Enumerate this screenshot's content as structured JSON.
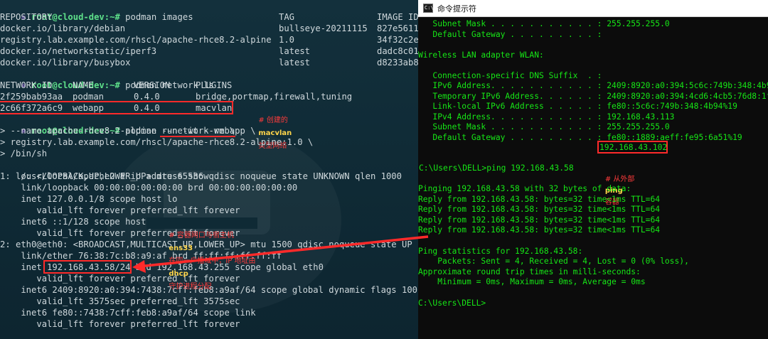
{
  "terminal": {
    "prompt_user": "root@cloud-dev:~#",
    "cmd_images": "podman images",
    "images_header": {
      "repository": "REPOSITORY",
      "tag": "TAG",
      "image_id": "IMAGE ID"
    },
    "images": [
      {
        "repository": "docker.io/library/debian",
        "tag": "bullseye-20211115",
        "image_id": "827e5611"
      },
      {
        "repository": "registry.lab.example.com/rhscl/apache-rhce8.2-alpine",
        "tag": "1.0",
        "image_id": "34f32c2e"
      },
      {
        "repository": "docker.io/networkstatic/iperf3",
        "tag": "latest",
        "image_id": "dadc8c01"
      },
      {
        "repository": "docker.io/library/busybox",
        "tag": "latest",
        "image_id": "d8233ab8"
      }
    ],
    "cmd_network": "podman network ls",
    "network_header": {
      "id": "NETWORK ID",
      "name": "NAME",
      "version": "VERSION",
      "plugins": "PLUGINS"
    },
    "networks": [
      {
        "id": "2f259bab93aa",
        "name": "podman",
        "version": "0.4.0",
        "plugins": "bridge,portmap,firewall,tuning"
      },
      {
        "id": "2c66f372a6c9",
        "name": "webapp",
        "version": "0.4.0",
        "plugins": "macvlan"
      }
    ],
    "annotation_network": {
      "prefix": "# 创建的",
      "keyword": "macvlan",
      "suffix": "类型网络"
    },
    "cmd_run": "podman run -it --rm \\",
    "run_lines": [
      "> --name apache-rhce8.2-alpine --network webapp \\",
      "> registry.lab.example.com/rhscl/apache-rhce8.2-alpine:1.0 \\",
      "> /bin/sh"
    ],
    "shell_prompt": "/usr/local/apache2 #",
    "cmd_ip": "ip address show",
    "ip_output": [
      "1: lo: <LOOPBACK,UP,LOWER_UP> mtu 65536 qdisc noqueue state UNKNOWN qlen 1000",
      "    link/loopback 00:00:00:00:00:00 brd 00:00:00:00:00:00",
      "    inet 127.0.0.1/8 scope host lo",
      "       valid_lft forever preferred_lft forever",
      "    inet6 ::1/128 scope host",
      "       valid_lft forever preferred_lft forever",
      "2: eth0@eth0: <BROADCAST,MULTICAST,UP,LOWER_UP> mtu 1500 qdisc noqueue state UP",
      "    link/ether 76:38:7c:b8:a9:af brd ff:ff:ff:ff:ff:ff",
      "    inet 192.168.43.58/24 brd 192.168.43.255 scope global eth0",
      "       valid_lft forever preferred_lft forever",
      "    inet6 2409:8920:a0:394:7438:7cff:feb8:a9af/64 scope global dynamic flags 100",
      "       valid_lft 3575sec preferred_lft 3575sec",
      "    inet6 fe80::7438:7cff:feb8:a9af/64 scope link",
      "       valid_lft forever preferred_lft forever"
    ],
    "container_ip": "192.168.43.58/24",
    "annotation_ip": {
      "p1": "# 容器网口与宿主机",
      "k1": "ens33",
      "p2": "在同一广播域中，IP 地址由",
      "k2": "dhcp",
      "p3": "守护进程分配"
    }
  },
  "cmd": {
    "title": "命令提示符",
    "icon_text": "C:\\",
    "top_lines": [
      "   Subnet Mask . . . . . . . . . . . : 255.255.255.0",
      "   Default Gateway . . . . . . . . . :",
      "",
      "Wireless LAN adapter WLAN:",
      "",
      "   Connection-specific DNS Suffix  . :",
      "   IPv6 Address. . . . . . . . . . . : 2409:8920:a0:394:5c6c:749b:348:4b94",
      "   Temporary IPv6 Address. . . . . . : 2409:8920:a0:394:4cd6:4cb5:76d8:1fb5",
      "   Link-local IPv6 Address . . . . . : fe80::5c6c:749b:348:4b94%19",
      "   IPv4 Address. . . . . . . . . . . : 192.168.43.113",
      "   Subnet Mask . . . . . . . . . . . : 255.255.255.0",
      "   Default Gateway . . . . . . . . . : fe80::1889:aeff:fe95:6a51%19"
    ],
    "gateway_ipv4": "192.168.43.102",
    "ping_cmd": "C:\\Users\\DELL>ping 192.168.43.58",
    "annotation_ping": {
      "prefix": "# 从外部",
      "keyword": "ping",
      "suffix": "容器"
    },
    "ping_lines": [
      "Pinging 192.168.43.58 with 32 bytes of data:",
      "Reply from 192.168.43.58: bytes=32 time<1ms TTL=64",
      "Reply from 192.168.43.58: bytes=32 time<1ms TTL=64",
      "Reply from 192.168.43.58: bytes=32 time<1ms TTL=64",
      "Reply from 192.168.43.58: bytes=32 time<1ms TTL=64",
      "",
      "Ping statistics for 192.168.43.58:",
      "    Packets: Sent = 4, Received = 4, Lost = 0 (0% loss),",
      "Approximate round trip times in milli-seconds:",
      "    Minimum = 0ms, Maximum = 0ms, Average = 0ms",
      "",
      "C:\\Users\\DELL>"
    ],
    "colors": {
      "text": "#16e616",
      "background": "#0c0c0c"
    }
  },
  "colors": {
    "annotation_red": "#ff2a2a",
    "annotation_yellow": "#ffd54a",
    "prompt_green": "#5ee08a"
  }
}
